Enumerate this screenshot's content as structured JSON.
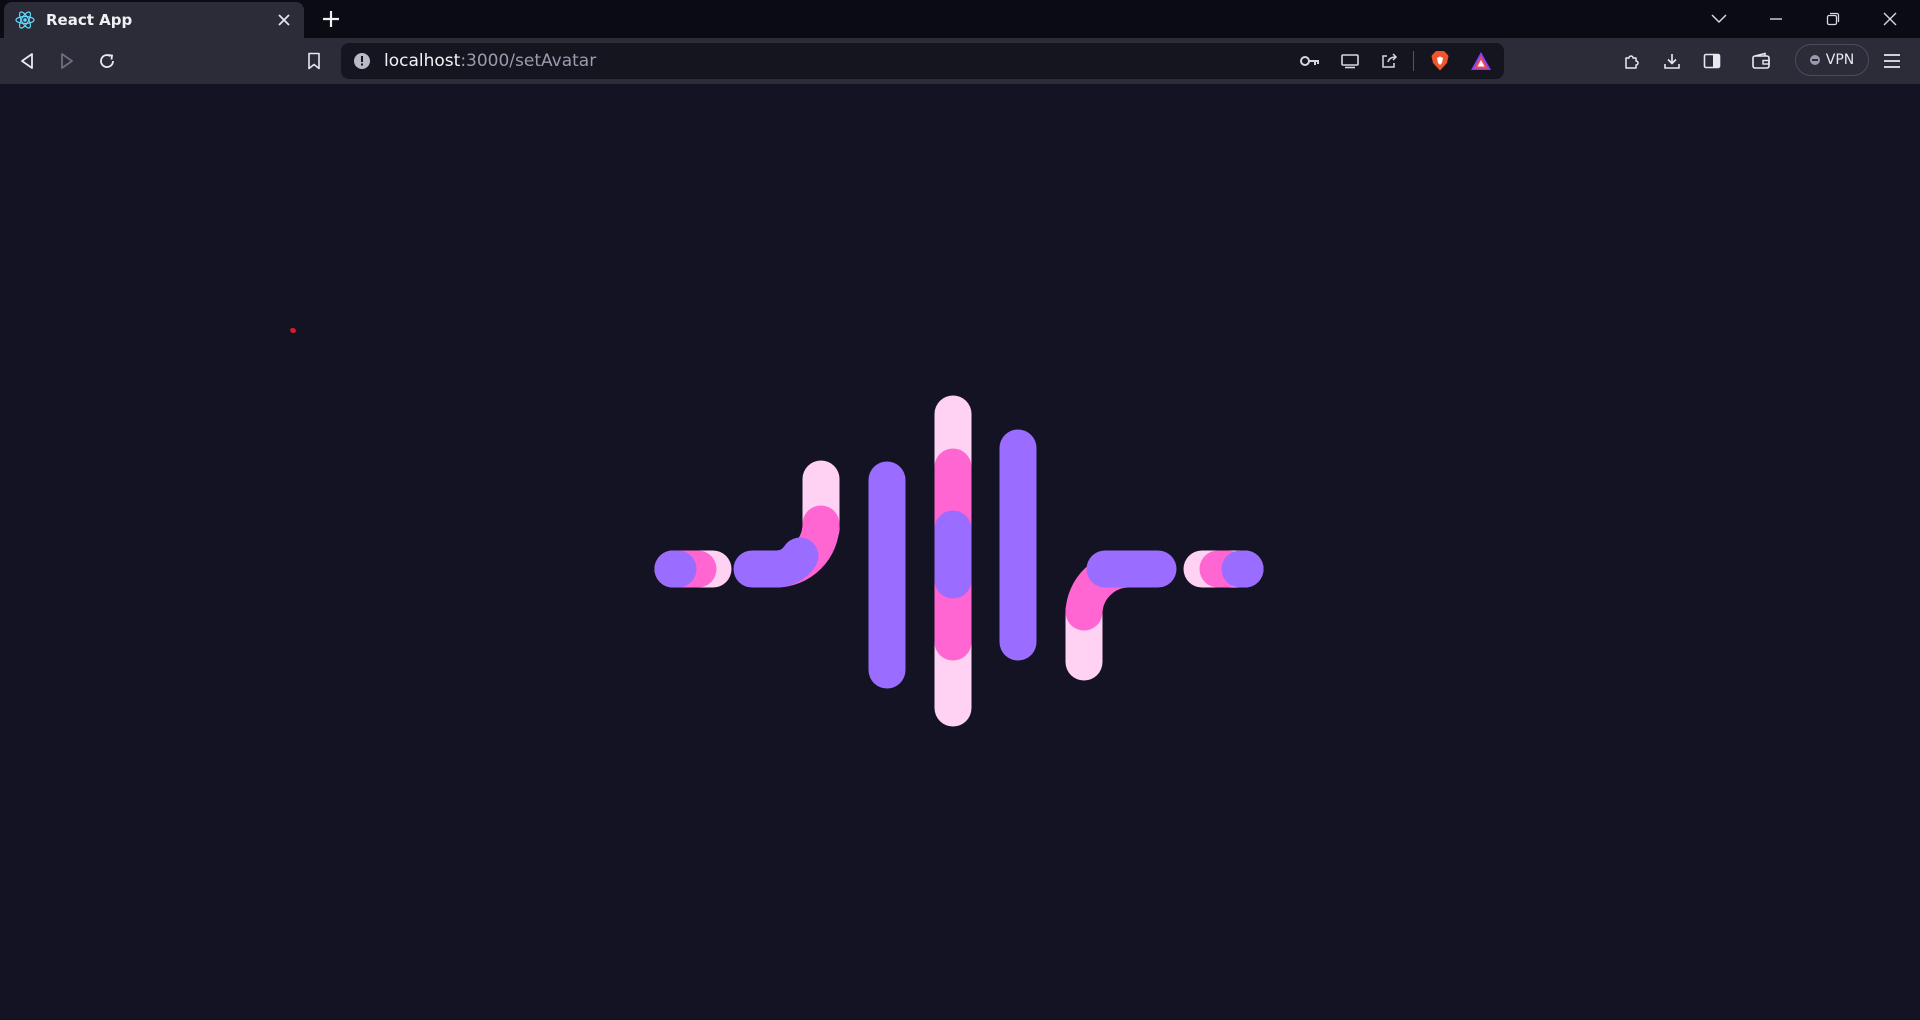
{
  "browser": {
    "tab": {
      "title": "React App",
      "favicon": "react-logo-icon",
      "close": "close-icon"
    },
    "new_tab": "plus-icon",
    "window_controls": [
      "tab-search-icon",
      "minimize-icon",
      "restore-icon",
      "close-window-icon"
    ],
    "toolbar": {
      "back": "back-arrow-icon",
      "forward": "forward-arrow-icon",
      "reload": "reload-icon",
      "bookmark": "bookmark-icon"
    },
    "url": {
      "host": "localhost",
      "path": ":3000/setAvatar"
    },
    "url_actions": [
      "key-icon",
      "cast-icon",
      "share-icon",
      "brave-shields-icon",
      "brave-rewards-icon"
    ],
    "right_actions": [
      "extensions-icon",
      "download-icon",
      "sidebar-icon",
      "wallet-icon"
    ],
    "vpn_label": "VPN",
    "menu": "hamburger-menu-icon"
  },
  "colors": {
    "page_bg": "#131324",
    "chrome_bg": "#2c2c38",
    "violet": "#9a6cff",
    "pink": "#ff66d1",
    "light_pink": "#ffd2f4"
  },
  "loader_icon": "audio-wave-loader-icon"
}
